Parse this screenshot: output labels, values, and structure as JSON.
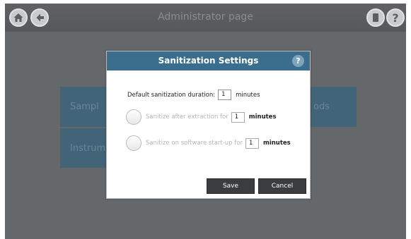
{
  "header": {
    "title": "Administrator page"
  },
  "tiles": {
    "left_top": "Sampl",
    "left_bottom": "Instrume",
    "right_top": "ods"
  },
  "dialog": {
    "title": "Sanitization Settings",
    "help": "?",
    "default_duration_label": "Default sanitization duration:",
    "default_duration_value": "1",
    "default_duration_unit": "minutes",
    "after_extraction_label": "Sanitize after extraction for",
    "after_extraction_value": "1",
    "after_extraction_unit": "minutes",
    "startup_label": "Sanitize on software start-up for",
    "startup_value": "1",
    "startup_unit": "minutes",
    "save_label": "Save",
    "cancel_label": "Cancel"
  },
  "colors": {
    "header_bg": "#3a6e8c",
    "tile_bg": "#3e6a86",
    "button_bg": "#3a3c3e"
  }
}
